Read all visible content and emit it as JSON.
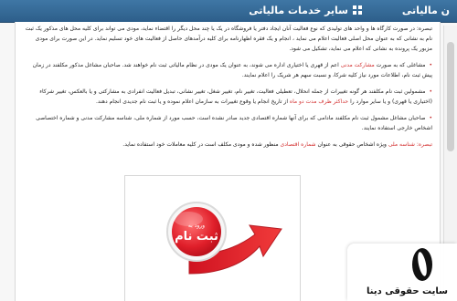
{
  "header": {
    "services_label": "سایر خدمات مالیاتی",
    "tax_tab_label": "ن مالیاتی",
    "accent": "#2f5f8b"
  },
  "content": {
    "note_1": "تبصره: در صورت کارگاه ها و واحد های تولیدی که نوع فعالیت آنان ایجاد دفتر یا فروشگاه در یک یا چند محل دیگر را اقتضاء نماید، مودی می تواند برای کلیه محل های مذکور یک ثبت نام به نشانی که به عنوان محل اصلی فعالیت اعلام می نماید ، انجام و یک فقره اظهارنامه برای کلیه درآمدهای حاصل از فعالیت های خود تسلیم نماید. در این صورت برای مودی مزبور یک پرونده به نشانی که اعلام می نماید، تشکیل می شود.",
    "para_2_prefix": "مشاغلی که به صورت",
    "para_2_link": "مشارکت مدنی",
    "para_2_suffix": "اعم از قهری یا اختیاری اداره می شوند، به عنوان یک مودی در نظام مالیاتی ثبت نام خواهند شد. صاحبان مشاغل مذکور مکلفند در زمان پیش ثبت نام، اطلاعات مورد نیاز کلیه شرکا، و نسبت سهم هر شریک را اعلام نمایند.",
    "para_3_prefix": "مشمولین ثبت نام مکلفند هر گونه تغییرات از جمله انحلال، تعطیلی فعالیت، تغییر نام، تغییر شغل، تغییر نشانی، تبدیل فعالیت انفرادی به مشارکتی و یا بالعکس، تغییر شرکاء (اختیاری یا قهری) و یا سایر موارد را",
    "para_3_highlight": "حداکثر ظرف مدت دو ماه",
    "para_3_suffix": "از تاریخ انجام یا وقوع تغییرات به سازمان اعلام نموده و یا ثبت نام جدیدی انجام دهند.",
    "para_4": "صاحبان مشاغل مشمول ثبت نام مکلفند مادامی که برای آنها شماره اقتصادی جدید صادر نشده است، حسب مورد از شماره ملی، شناسه مشارکت مدنی و شماره اختصاصی اشخاص خارجی استفاده نمایند.",
    "note_2_label": "تبصره:",
    "note_2_link": "شناسه ملی",
    "note_2_suffix": "ویژه اشخاص حقوقی به عنوان",
    "note_2_highlight": "شماره اقتصادی",
    "note_2_tail": "منظور شده و مودی مکلف است در کلیه معاملات خود استفاده نماید."
  },
  "graphic": {
    "badge_label": "ثبت نام",
    "badge_small_label": "ورود به",
    "arrow_color": "#d91f2a"
  },
  "watermark": {
    "site_name": "سایت حقوقی دینا"
  }
}
